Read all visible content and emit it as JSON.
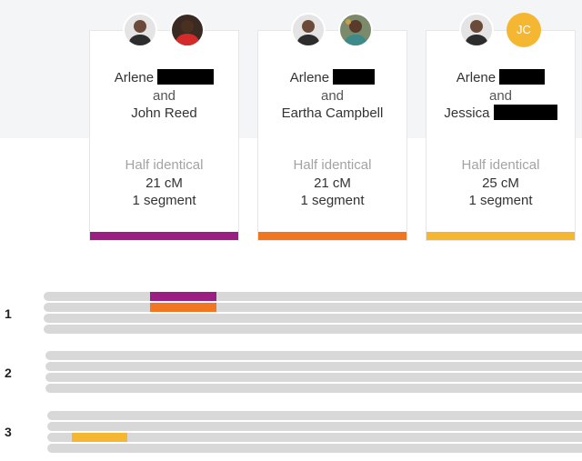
{
  "matches": [
    {
      "person_a": "Arlene",
      "conjunction": "and",
      "person_b": "John Reed",
      "relationship": "Half identical",
      "amount": "21 cM",
      "segments": "1 segment",
      "color": "#9b1f83"
    },
    {
      "person_a": "Arlene",
      "conjunction": "and",
      "person_b": "Eartha Campbell",
      "relationship": "Half identical",
      "amount": "21 cM",
      "segments": "1 segment",
      "color": "#f07621"
    },
    {
      "person_a": "Arlene",
      "conjunction": "and",
      "person_b": "Jessica",
      "partner_initials": "JC",
      "relationship": "Half identical",
      "amount": "25 cM",
      "segments": "1 segment",
      "color": "#f5b731"
    }
  ],
  "chromosomes": [
    {
      "label": "1"
    },
    {
      "label": "2"
    },
    {
      "label": "3"
    }
  ]
}
